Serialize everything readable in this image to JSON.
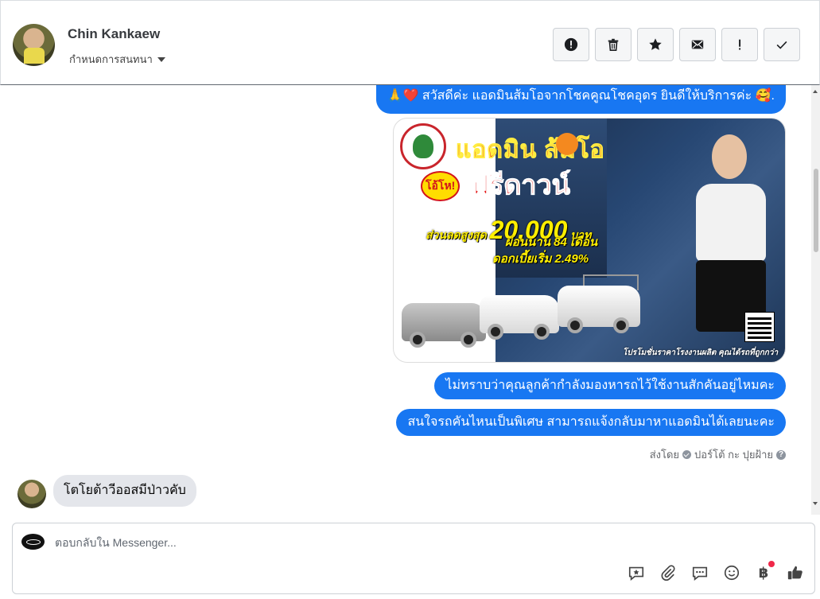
{
  "header": {
    "contact_name": "Chin Kankaew",
    "conversation_settings": "กำหนดการสนทนา",
    "actions": [
      {
        "name": "report-icon"
      },
      {
        "name": "trash-icon"
      },
      {
        "name": "star-icon"
      },
      {
        "name": "envelope-icon"
      },
      {
        "name": "exclamation-icon"
      },
      {
        "name": "check-icon"
      }
    ]
  },
  "messages": {
    "greeting": "🙏❤️ สวัสดีค่ะ แอดมินส้มโอจากโชคคูณโชคอุดร ยินดีให้บริการค่ะ 🥰.",
    "promo_image": {
      "title": "แอดมิน  ส้มโอ",
      "free_down": "ฟรีดาวน์",
      "burst": "โอ้โห!",
      "discount_label": "ส่วนลดสูงสุด",
      "discount_value": "20,000",
      "discount_unit": "บาท",
      "installment": "ผ่อนนาน 84 เดือน",
      "interest": "ดอกเบี้ยเริ่ม 2.49%",
      "footer": "โปรโมชั่นราคาโรงงานผลิต คุณได้รถที่ถูกกว่า"
    },
    "question1": "ไม่ทราบว่าคุณลูกค้ากำลังมองหารถไว้ใช้งานสักคันอยู่ไหมคะ",
    "question2": "สนใจรถคันไหนเป็นพิเศษ สามารถแจ้งกลับมาหาแอดมินได้เลยนะคะ",
    "sent_by_label": "ส่งโดย",
    "sent_by_name": "ปอร์โต้ กะ ปุยฝ้าย",
    "incoming": "โตโยต้าวีออสมีป่าวคับ"
  },
  "composer": {
    "placeholder": "ตอบกลับใน Messenger...",
    "currency_symbol": "฿"
  }
}
